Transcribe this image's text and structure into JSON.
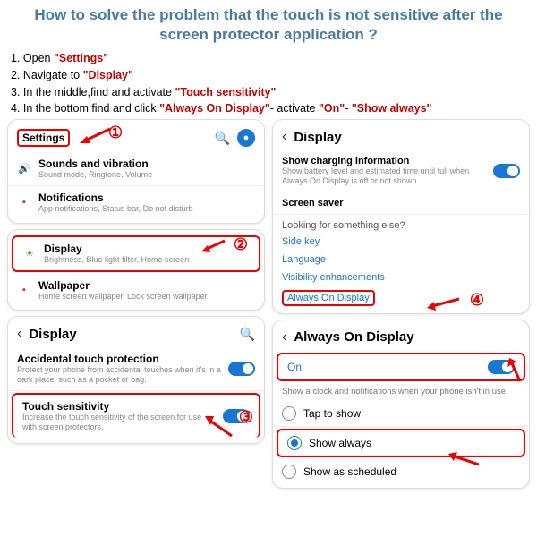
{
  "header": "How to solve the problem that the touch is not sensitive after the screen protector application ?",
  "steps": {
    "s1a": "1. Open ",
    "s1b": "\"Settings\"",
    "s2a": "2. Navigate to ",
    "s2b": "\"Display\"",
    "s3a": "3. In the middle,find and activate ",
    "s3b": "\"Touch sensitivity\"",
    "s4a": "4. In the bottom find and click ",
    "s4b": "\"Always On Display\"",
    "s4c": "- activate ",
    "s4d": "\"On\"",
    "s4e": "- ",
    "s4f": "\"Show always\""
  },
  "nums": {
    "n1": "①",
    "n2": "②",
    "n3": "③",
    "n4": "④"
  },
  "left1": {
    "title": "Settings",
    "sounds": {
      "t": "Sounds and vibration",
      "s": "Sound mode, Ringtone, Volume"
    },
    "notif": {
      "t": "Notifications",
      "s": "App notifications, Status bar, Do not disturb"
    }
  },
  "left2": {
    "display": {
      "t": "Display",
      "s": "Brightness, Blue light filter, Home screen"
    },
    "wallpaper": {
      "t": "Wallpaper",
      "s": "Home screen wallpaper, Lock screen wallpaper"
    }
  },
  "left3": {
    "title": "Display",
    "acc": {
      "t": "Accidental touch protection",
      "s": "Protect your phone from accidental touches when it's in a dark place, such as a pocket or bag."
    },
    "touch": {
      "t": "Touch sensitivity",
      "s": "Increase the touch sensitivity of the screen for use with screen protectors."
    }
  },
  "right1": {
    "title": "Display",
    "charging": {
      "t": "Show charging information",
      "s": "Show battery level and estimated time until full when Always On Display is off or not shown."
    },
    "saver": "Screen saver",
    "looking": "Looking for something else?",
    "links": {
      "side": "Side key",
      "lang": "Language",
      "vis": "Visibility enhancements",
      "aod": "Always On Display"
    }
  },
  "right2": {
    "title": "Always On Display",
    "on": "On",
    "desc": "Show a clock and notifications when your phone isn't in use.",
    "opts": {
      "tap": "Tap to show",
      "always": "Show always",
      "sched": "Show as scheduled"
    }
  }
}
